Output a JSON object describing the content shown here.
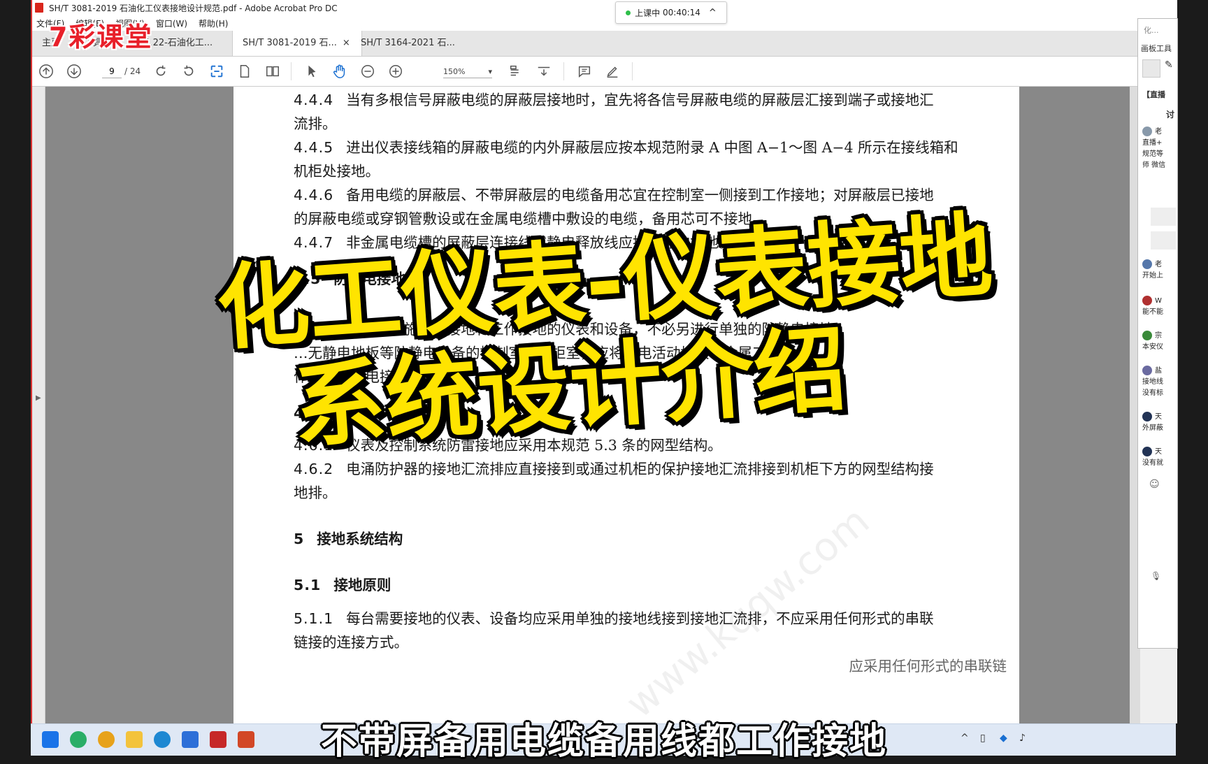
{
  "window": {
    "title": "SH/T 3081-2019 石油化工仪表接地设计规范.pdf - Adobe Acrobat Pro DC",
    "menu": [
      "文件(F)",
      "编辑(E)",
      "视图(V)",
      "窗口(W)",
      "帮助(H)"
    ]
  },
  "timer": {
    "status": "上课中",
    "time": "00:40:14",
    "chevron": "^"
  },
  "brand": "7彩课堂",
  "tabs": [
    {
      "label": "主页"
    },
    {
      "label": "工具"
    },
    {
      "label": "SH 3.22-石油化工..."
    },
    {
      "label": "SH/T 3081-2019 石...",
      "active": true,
      "close": "×"
    },
    {
      "label": "SH/T 3164-2021 石..."
    }
  ],
  "toolbar": {
    "page_current": "9",
    "page_total": "/ 24",
    "zoom": "150%",
    "zoom_arrow": "▾"
  },
  "document": {
    "paragraphs": [
      {
        "num": "4.4.4",
        "text": "当有多根信号屏蔽电缆的屏蔽层接地时，宜先将各信号屏蔽电缆的屏蔽层汇接到端子或接地汇",
        "cont": "流排。"
      },
      {
        "num": "4.4.5",
        "text": "进出仪表接线箱的屏蔽电缆的内外屏蔽层应按本规范附录 A 中图 A−1～图 A−4 所示在接线箱和",
        "cont": "机柜处接地。"
      },
      {
        "num": "4.4.6",
        "text": "备用电缆的屏蔽层、不带屏蔽层的电缆备用芯宜在控制室一侧接到工作接地；对屏蔽层已接地",
        "cont": "的屏蔽电缆或穿钢管敷设或在金属电缆槽中敷设的电缆，备用芯可不接地。"
      },
      {
        "num": "4.4.7",
        "text": "非金属电缆槽的屏蔽层连接线或静电释放线应接到保护接地。",
        "cont": ""
      }
    ],
    "heading_45": {
      "num": "4.5",
      "text": "防静电接地"
    },
    "p_451_partial": {
      "num": "4.5.1",
      "text": "对于已实施保护接地和工作接地的仪表和设备，不必另进行单独的防静电接地。"
    },
    "p_452_line": "…无静电地板等防静电设备的控制室或机柜室，应将静电活动地板、金属工",
    "p_452_cont": "作台等防静电接地。",
    "heading_46": {
      "num": "4.6",
      "text": ""
    },
    "p_461": {
      "num": "4.6.1",
      "text": "仪表及控制系统防雷接地应采用本规范 5.3 条的网型结构。"
    },
    "p_462": {
      "num": "4.6.2",
      "text": "电涌防护器的接地汇流排应直接接到或通过机柜的保护接地汇流排接到机柜下方的网型结构接",
      "cont": "地排。"
    },
    "heading_5": {
      "num": "5",
      "text": "接地系统结构"
    },
    "heading_51": {
      "num": "5.1",
      "text": "接地原则"
    },
    "p_511": {
      "num": "5.1.1",
      "text": "每台需要接地的仪表、设备均应采用单独的接地线接到接地汇流排，不应采用任何形式的串联",
      "cont": "链接的连接方式。"
    },
    "p_512_partial": "应采用任何形式的串联链",
    "watermark": "www.kqqw.com"
  },
  "overlay_title": {
    "line1": "化工仪表-仪表接地",
    "line2": "系统设计介绍"
  },
  "subtitle": "不带屏备用电缆备用线都工作接地",
  "chat": {
    "title": "化...",
    "tools": "画板工具",
    "tag": "【直播",
    "tag2": "讨",
    "messages": [
      {
        "user": "老",
        "text": "直播+",
        "text2": "规范等",
        "text3": "师 微信",
        "color": "#8899aa"
      },
      {
        "user": "老",
        "text": "开始上",
        "color": "#5577aa"
      },
      {
        "user": "W",
        "text": "能不能",
        "color": "#b03030"
      },
      {
        "user": "宗",
        "text": "本安仪",
        "color": "#3a8a3a"
      },
      {
        "user": "盐",
        "text": "接地线",
        "text2": "没有标",
        "color": "#6a6aa0"
      },
      {
        "user": "天",
        "text": "外屏蔽",
        "color": "#223355"
      },
      {
        "user": "天",
        "text": "没有就",
        "color": "#223355"
      }
    ]
  },
  "colors": {
    "accent_yellow": "#ffe400",
    "brand_red": "#e8202a",
    "pdf_red": "#d9261c"
  }
}
